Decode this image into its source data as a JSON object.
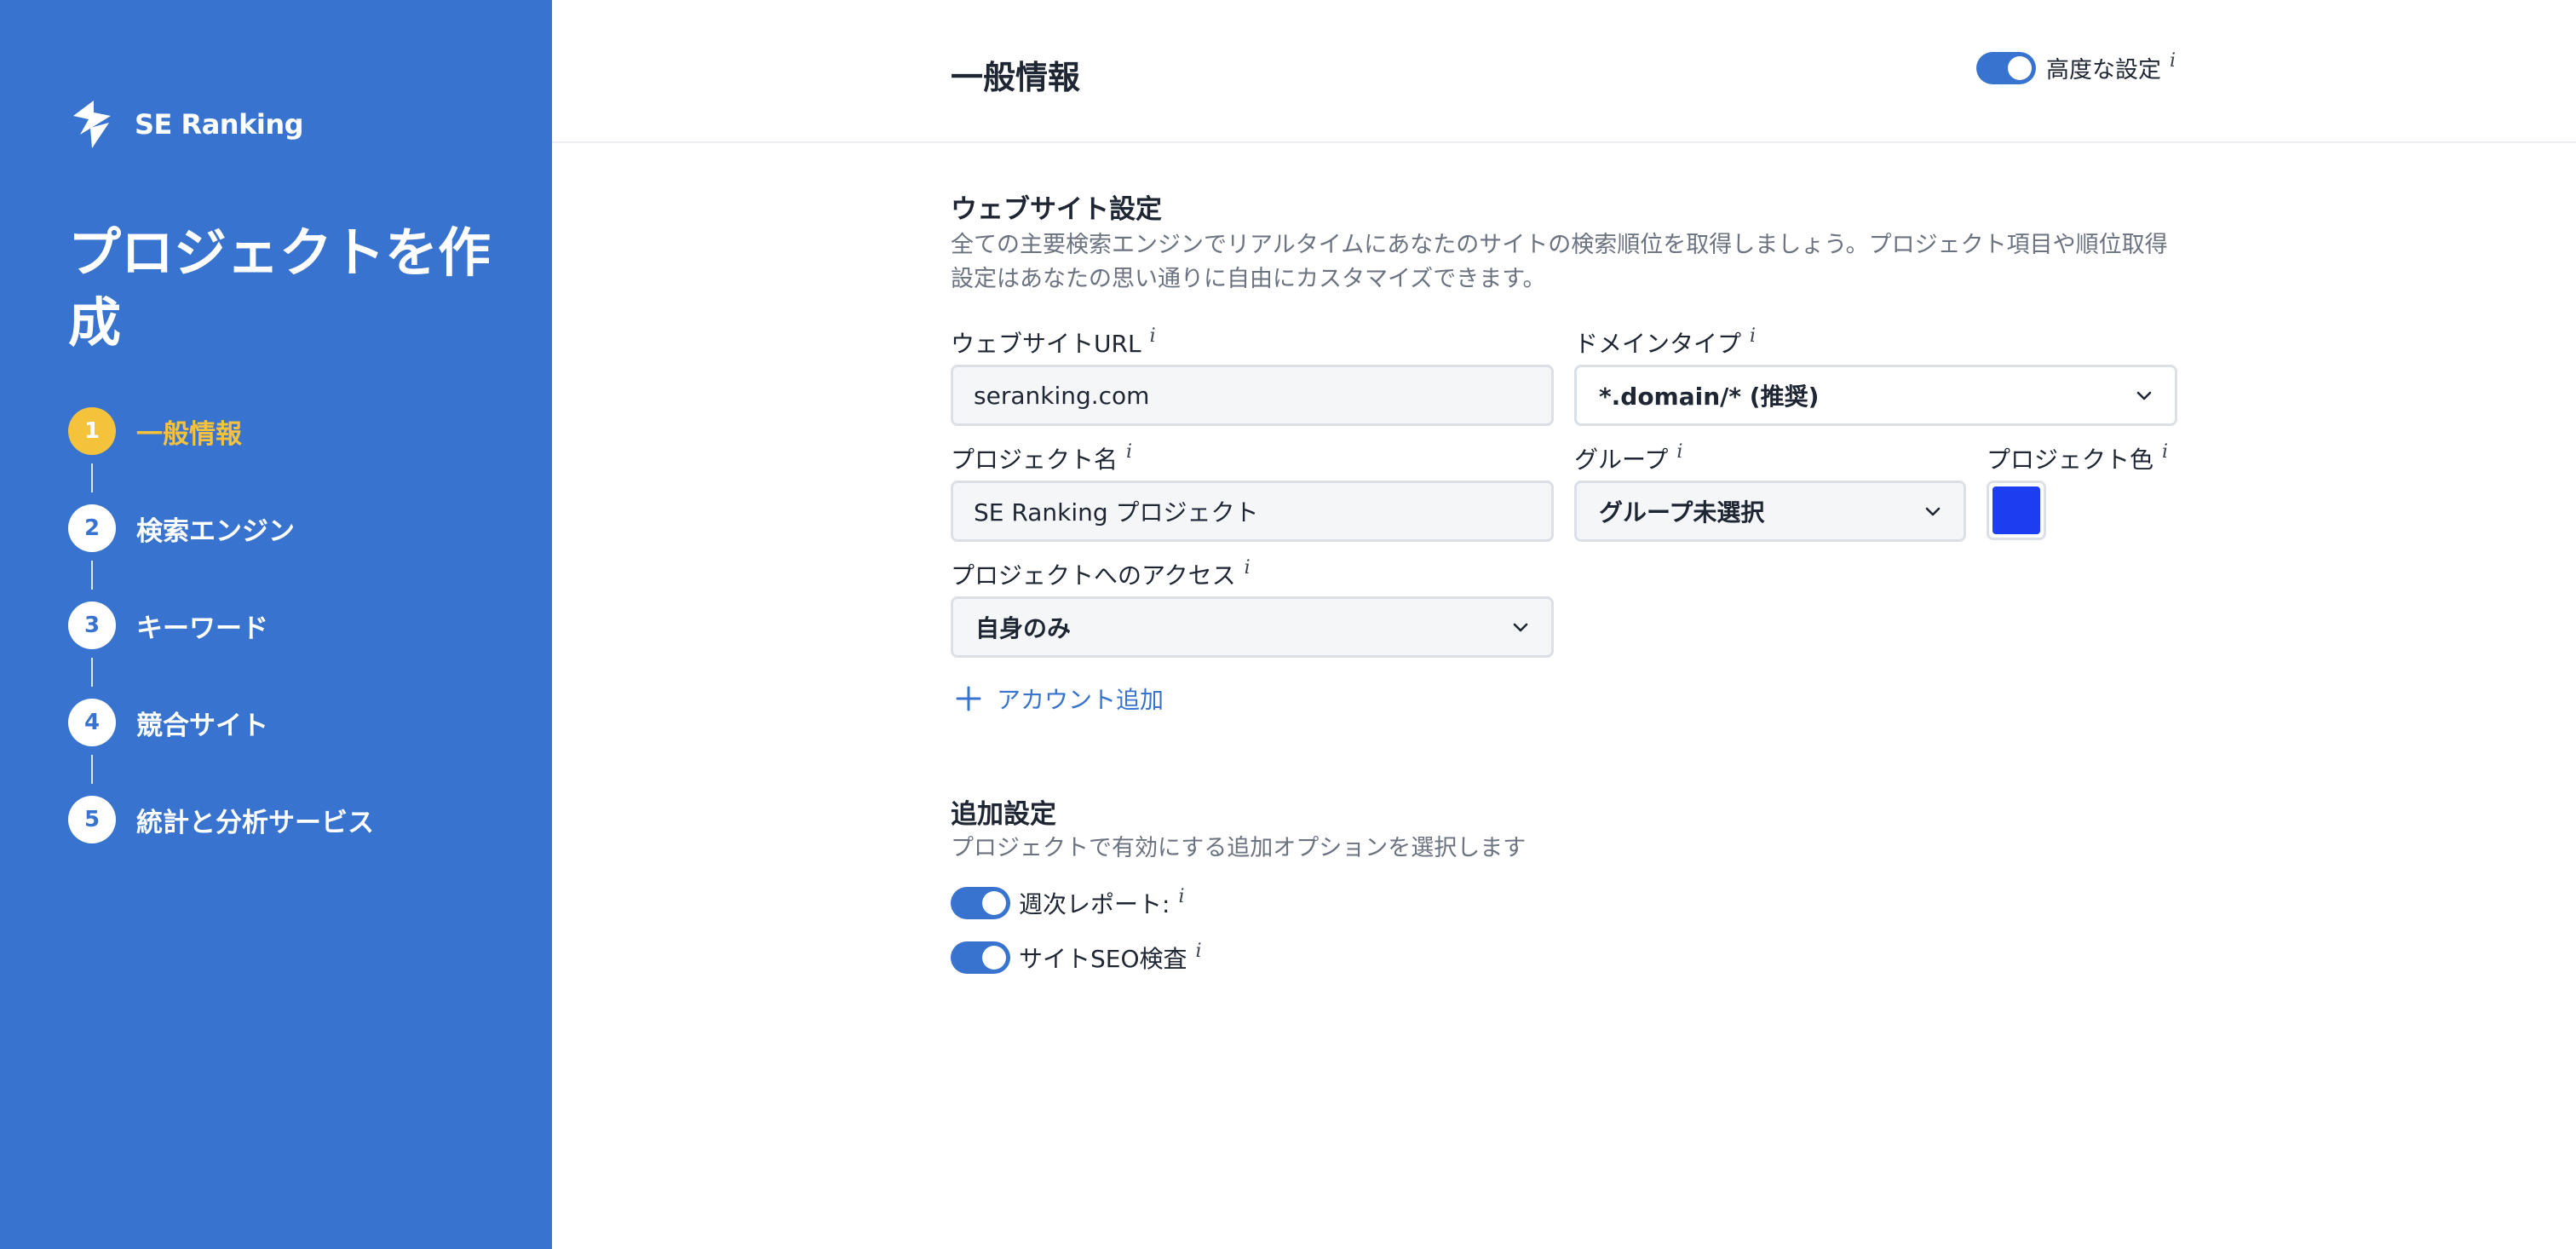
{
  "sidebar": {
    "logo_text": "SE Ranking",
    "title": "プロジェクトを作成",
    "steps": [
      {
        "num": "1",
        "label": "一般情報"
      },
      {
        "num": "2",
        "label": "検索エンジン"
      },
      {
        "num": "3",
        "label": "キーワード"
      },
      {
        "num": "4",
        "label": "競合サイト"
      },
      {
        "num": "5",
        "label": "統計と分析サービス"
      }
    ]
  },
  "header": {
    "title": "一般情報",
    "advanced_label": "高度な設定",
    "advanced_enabled": true
  },
  "info_mark": "i",
  "website": {
    "title": "ウェブサイト設定",
    "description": "全ての主要検索エンジンでリアルタイムにあなたのサイトの検索順位を取得しましょう。プロジェクト項目や順位取得設定はあなたの思い通りに自由にカスタマイズできます。",
    "url_label": "ウェブサイトURL",
    "url_value": "seranking.com",
    "domain_label": "ドメインタイプ",
    "domain_value": "*.domain/* (推奨)",
    "name_label": "プロジェクト名",
    "name_value": "SE Ranking プロジェクト",
    "group_label": "グループ",
    "group_value": "グループ未選択",
    "color_label": "プロジェクト色",
    "color_value": "#1d3ef0",
    "access_label": "プロジェクトへのアクセス",
    "access_value": "自身のみ",
    "add_account_label": "アカウント追加"
  },
  "additional": {
    "title": "追加設定",
    "description": "プロジェクトで有効にする追加オプションを選択します",
    "options": [
      {
        "label": "週次レポート:",
        "enabled": true
      },
      {
        "label": "サイトSEO検査",
        "enabled": true
      }
    ]
  },
  "colors": {
    "sidebar_bg": "#3874cf",
    "active_step": "#f5c33b",
    "accent": "#3874cf"
  }
}
